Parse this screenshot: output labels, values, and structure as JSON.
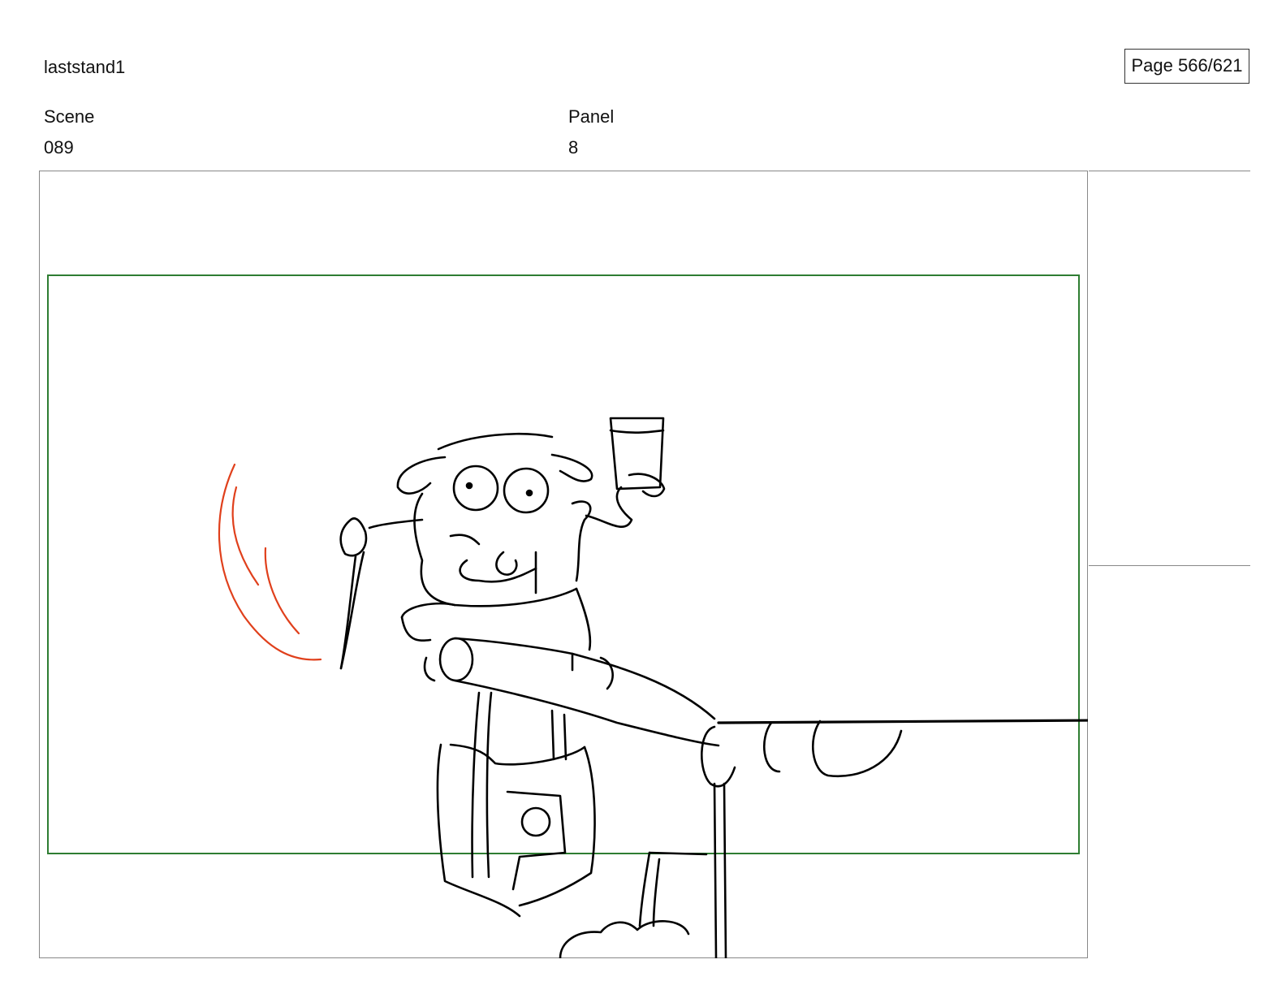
{
  "header": {
    "project_name": "laststand1",
    "page_indicator": "Page 566/621"
  },
  "scene": {
    "label": "Scene",
    "value": "089"
  },
  "panel": {
    "label": "Panel",
    "value": "8"
  },
  "colors": {
    "safe_area": "#2e7d32",
    "motion_lines": "#e0401c",
    "ink": "#000000",
    "frame_border": "#888888"
  },
  "icons": [
    "storyboard-sketch"
  ]
}
